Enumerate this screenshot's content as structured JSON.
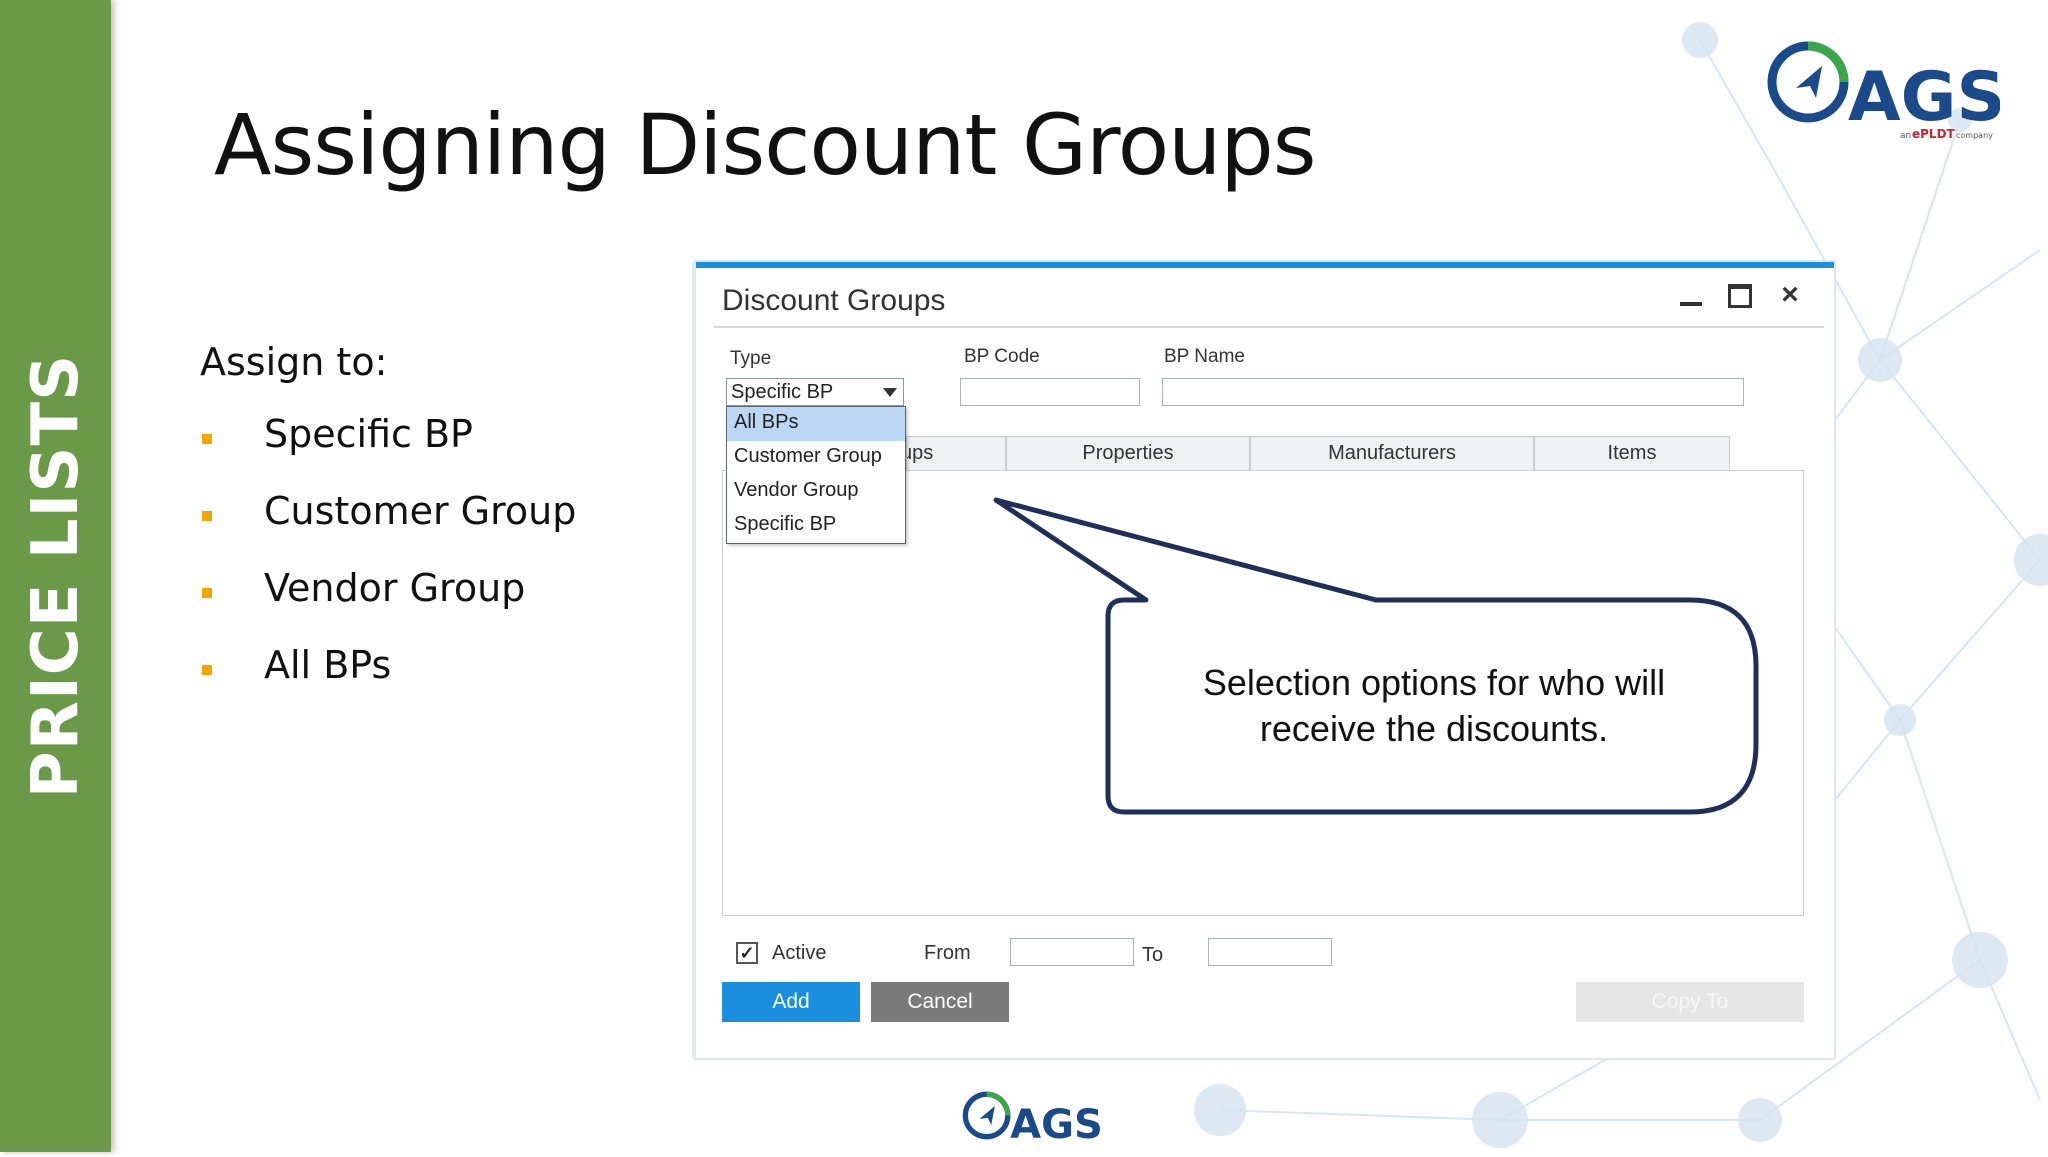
{
  "side_bar": {
    "label": "PRICE LISTS",
    "color": "#6a9a48"
  },
  "slide": {
    "title": "Assigning Discount Groups",
    "assign_heading": "Assign to:",
    "bullets": [
      "Specific BP",
      "Customer Group",
      "Vendor Group",
      "All BPs"
    ],
    "bullet_color": "#f0a500"
  },
  "logo": {
    "brand": "AGS",
    "tagline_prefix": "an",
    "tagline_brand": "ePLDT",
    "tagline_suffix": "company",
    "brand_color": "#1a4a8a",
    "ring_color": "#3aa54a"
  },
  "window": {
    "title": "Discount Groups",
    "accent_color": "#1a8fe0",
    "controls": {
      "minimize": "minimize-icon",
      "maximize": "maximize-icon",
      "close": "×"
    },
    "fields": {
      "type_label": "Type",
      "type_value": "Specific BP",
      "bp_code_label": "BP Code",
      "bp_name_label": "BP Name"
    },
    "dropdown_options": [
      "All BPs",
      "Customer Group",
      "Vendor Group",
      "Specific BP"
    ],
    "dropdown_selected": "All BPs",
    "tabs": [
      "Groups",
      "Properties",
      "Manufacturers",
      "Items"
    ],
    "tab_groups_visible": "ups",
    "footer": {
      "active_label": "Active",
      "active_checked": "✓",
      "from_label": "From",
      "to_label": "To"
    },
    "buttons": {
      "add": "Add",
      "cancel": "Cancel",
      "copy_to": "Copy To"
    }
  },
  "callout": {
    "line1": "Selection options for who will",
    "line2": "receive the discounts.",
    "border_color": "#1f2f5a"
  }
}
